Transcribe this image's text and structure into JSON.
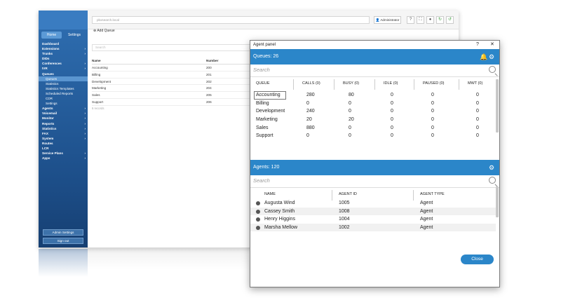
{
  "admin": {
    "url_text": "pbxsearch.local",
    "admin_button": "Administrator",
    "side_tabs": [
      "Home",
      "Settings"
    ],
    "nav": [
      {
        "label": "Dashboard",
        "arrow": false,
        "sub": false,
        "sel": false
      },
      {
        "label": "Extensions",
        "arrow": true,
        "sub": false,
        "sel": false
      },
      {
        "label": "Trunks",
        "arrow": true,
        "sub": false,
        "sel": false
      },
      {
        "label": "DIDs",
        "arrow": false,
        "sub": false,
        "sel": false
      },
      {
        "label": "Conferences",
        "arrow": true,
        "sub": false,
        "sel": false
      },
      {
        "label": "IVR",
        "arrow": true,
        "sub": false,
        "sel": false
      },
      {
        "label": "Queues",
        "arrow": false,
        "sub": false,
        "sel": false
      },
      {
        "label": "Queues",
        "arrow": false,
        "sub": true,
        "sel": true
      },
      {
        "label": "Statistics",
        "arrow": false,
        "sub": true,
        "sel": false
      },
      {
        "label": "Statistics Templates",
        "arrow": false,
        "sub": true,
        "sel": false
      },
      {
        "label": "Scheduled Reports",
        "arrow": false,
        "sub": true,
        "sel": false
      },
      {
        "label": "CDR",
        "arrow": false,
        "sub": true,
        "sel": false
      },
      {
        "label": "Settings",
        "arrow": false,
        "sub": true,
        "sel": false
      },
      {
        "label": "Agents",
        "arrow": true,
        "sub": false,
        "sel": false
      },
      {
        "label": "Voicemail",
        "arrow": true,
        "sub": false,
        "sel": false
      },
      {
        "label": "Monitor",
        "arrow": true,
        "sub": false,
        "sel": false
      },
      {
        "label": "Reports",
        "arrow": true,
        "sub": false,
        "sel": false
      },
      {
        "label": "Statistics",
        "arrow": true,
        "sub": false,
        "sel": false
      },
      {
        "label": "FAX",
        "arrow": true,
        "sub": false,
        "sel": false
      },
      {
        "label": "System",
        "arrow": true,
        "sub": false,
        "sel": false
      },
      {
        "label": "Routes",
        "arrow": false,
        "sub": false,
        "sel": false
      },
      {
        "label": "LCR",
        "arrow": false,
        "sub": false,
        "sel": false
      },
      {
        "label": "Service Plans",
        "arrow": true,
        "sub": false,
        "sel": false
      },
      {
        "label": "Apps",
        "arrow": true,
        "sub": false,
        "sel": false
      }
    ],
    "admin_settings": "Admin Settings",
    "sign_out": "Sign out",
    "add_queue": "Add Queue",
    "search_placeholder": "Search",
    "table_headers": [
      "Name",
      "Number"
    ],
    "rows": [
      {
        "name": "Accounting",
        "number": "200"
      },
      {
        "name": "Billing",
        "number": "201"
      },
      {
        "name": "Development",
        "number": "202"
      },
      {
        "name": "Marketing",
        "number": "204"
      },
      {
        "name": "Sales",
        "number": "205"
      },
      {
        "name": "Support",
        "number": "206"
      }
    ],
    "footer": "6 records"
  },
  "panel": {
    "title": "Agent panel",
    "help": "?",
    "close_x": "✕",
    "queues_label": "Queues: 26",
    "search_placeholder": "Search",
    "queue_headers": [
      "QUEUE",
      "CALLS (0)",
      "BUSY (0)",
      "IDLE (0)",
      "PAUSED (0)",
      "MWT (0)"
    ],
    "queues": [
      [
        "Accounting",
        "280",
        "80",
        "0",
        "0",
        "0"
      ],
      [
        "Billing",
        "0",
        "0",
        "0",
        "0",
        "0"
      ],
      [
        "Development",
        "240",
        "0",
        "0",
        "0",
        "0"
      ],
      [
        "Marketing",
        "20",
        "20",
        "0",
        "0",
        "0"
      ],
      [
        "Sales",
        "880",
        "0",
        "0",
        "0",
        "0"
      ],
      [
        "Support",
        "0",
        "0",
        "0",
        "0",
        "0"
      ]
    ],
    "agents_label": "Agents: 120",
    "agent_search_placeholder": "Search",
    "agent_headers": [
      "NAME",
      "AGENT ID",
      "AGENT TYPE"
    ],
    "agents": [
      {
        "name": "Augusta Wind",
        "id": "1005",
        "type": "Agent"
      },
      {
        "name": "Cassey Smith",
        "id": "1008",
        "type": "Agent"
      },
      {
        "name": "Henry Higgins",
        "id": "1004",
        "type": "Agent"
      },
      {
        "name": "Marsha Mellow",
        "id": "1002",
        "type": "Agent"
      }
    ],
    "close_button": "Close"
  },
  "colors": {
    "accent": "#2b86c9",
    "sidebar": "#1d4f8a"
  }
}
